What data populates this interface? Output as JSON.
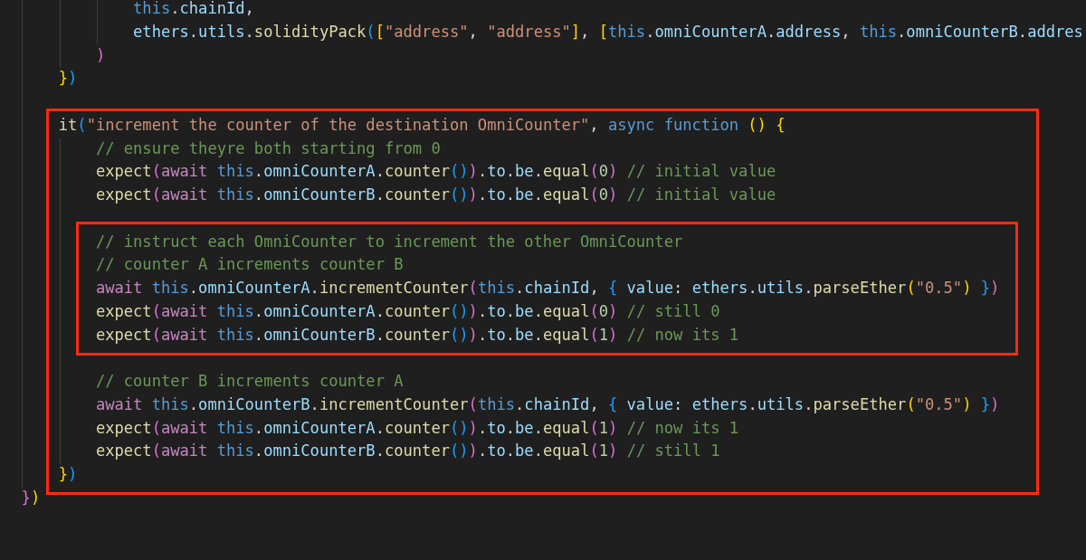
{
  "code": [
    {
      "kind": "block",
      "children": [
        {
          "kind": "block",
          "children": [
            {
              "kind": "block",
              "children": [
                {
                  "kind": "line",
                  "tokens": [
                    {
                      "kind": "keyword",
                      "text": "this"
                    },
                    {
                      "kind": "plain",
                      "text": "."
                    },
                    {
                      "kind": "property",
                      "text": "chainId"
                    },
                    {
                      "kind": "plain",
                      "text": ","
                    }
                  ]
                },
                {
                  "kind": "line",
                  "tokens": [
                    {
                      "kind": "property",
                      "text": "ethers"
                    },
                    {
                      "kind": "plain",
                      "text": "."
                    },
                    {
                      "kind": "property",
                      "text": "utils"
                    },
                    {
                      "kind": "plain",
                      "text": "."
                    },
                    {
                      "kind": "function",
                      "text": "solidityPack"
                    },
                    {
                      "kind": "bracket3",
                      "text": "("
                    },
                    {
                      "kind": "bracket1",
                      "text": "["
                    },
                    {
                      "kind": "string",
                      "text": "\"address\""
                    },
                    {
                      "kind": "plain",
                      "text": ", "
                    },
                    {
                      "kind": "string",
                      "text": "\"address\""
                    },
                    {
                      "kind": "bracket1",
                      "text": "]"
                    },
                    {
                      "kind": "plain",
                      "text": ", "
                    },
                    {
                      "kind": "bracket1",
                      "text": "["
                    },
                    {
                      "kind": "keyword",
                      "text": "this"
                    },
                    {
                      "kind": "plain",
                      "text": "."
                    },
                    {
                      "kind": "property",
                      "text": "omniCounterA"
                    },
                    {
                      "kind": "plain",
                      "text": "."
                    },
                    {
                      "kind": "property",
                      "text": "address"
                    },
                    {
                      "kind": "plain",
                      "text": ", "
                    },
                    {
                      "kind": "keyword",
                      "text": "this"
                    },
                    {
                      "kind": "plain",
                      "text": "."
                    },
                    {
                      "kind": "property",
                      "text": "omniCounterB"
                    },
                    {
                      "kind": "plain",
                      "text": "."
                    },
                    {
                      "kind": "property",
                      "text": "addres"
                    }
                  ]
                }
              ]
            },
            {
              "kind": "line",
              "tokens": [
                {
                  "kind": "bracket2",
                  "text": ")"
                }
              ]
            }
          ]
        },
        {
          "kind": "line",
          "tokens": [
            {
              "kind": "bracket1",
              "text": "}"
            },
            {
              "kind": "bracket3",
              "text": ")"
            }
          ]
        },
        {
          "kind": "blank"
        },
        {
          "kind": "frame",
          "children": [
            {
              "kind": "line",
              "tokens": [
                {
                  "kind": "function",
                  "text": "it"
                },
                {
                  "kind": "bracket3",
                  "text": "("
                },
                {
                  "kind": "string",
                  "text": "\"increment the counter of the destination OmniCounter\""
                },
                {
                  "kind": "plain",
                  "text": ", "
                },
                {
                  "kind": "keyword",
                  "text": "async "
                },
                {
                  "kind": "keyword",
                  "text": "function "
                },
                {
                  "kind": "bracket1",
                  "text": "()"
                },
                {
                  "kind": "bracket1",
                  "text": " {"
                }
              ]
            },
            {
              "kind": "block",
              "children": [
                {
                  "kind": "line",
                  "tokens": [
                    {
                      "kind": "comment",
                      "text": "// ensure theyre both starting from 0"
                    }
                  ]
                },
                {
                  "kind": "line",
                  "tokens": [
                    {
                      "kind": "function",
                      "text": "expect"
                    },
                    {
                      "kind": "bracket2",
                      "text": "("
                    },
                    {
                      "kind": "control",
                      "text": "await "
                    },
                    {
                      "kind": "keyword",
                      "text": "this"
                    },
                    {
                      "kind": "plain",
                      "text": "."
                    },
                    {
                      "kind": "property",
                      "text": "omniCounterA"
                    },
                    {
                      "kind": "plain",
                      "text": "."
                    },
                    {
                      "kind": "function",
                      "text": "counter"
                    },
                    {
                      "kind": "bracket3",
                      "text": "()"
                    },
                    {
                      "kind": "bracket2",
                      "text": ")"
                    },
                    {
                      "kind": "plain",
                      "text": "."
                    },
                    {
                      "kind": "property",
                      "text": "to"
                    },
                    {
                      "kind": "plain",
                      "text": "."
                    },
                    {
                      "kind": "property",
                      "text": "be"
                    },
                    {
                      "kind": "plain",
                      "text": "."
                    },
                    {
                      "kind": "function",
                      "text": "equal"
                    },
                    {
                      "kind": "bracket2",
                      "text": "("
                    },
                    {
                      "kind": "number",
                      "text": "0"
                    },
                    {
                      "kind": "bracket2",
                      "text": ") "
                    },
                    {
                      "kind": "comment",
                      "text": "// initial value"
                    }
                  ]
                },
                {
                  "kind": "line",
                  "tokens": [
                    {
                      "kind": "function",
                      "text": "expect"
                    },
                    {
                      "kind": "bracket2",
                      "text": "("
                    },
                    {
                      "kind": "control",
                      "text": "await "
                    },
                    {
                      "kind": "keyword",
                      "text": "this"
                    },
                    {
                      "kind": "plain",
                      "text": "."
                    },
                    {
                      "kind": "property",
                      "text": "omniCounterB"
                    },
                    {
                      "kind": "plain",
                      "text": "."
                    },
                    {
                      "kind": "function",
                      "text": "counter"
                    },
                    {
                      "kind": "bracket3",
                      "text": "()"
                    },
                    {
                      "kind": "bracket2",
                      "text": ")"
                    },
                    {
                      "kind": "plain",
                      "text": "."
                    },
                    {
                      "kind": "property",
                      "text": "to"
                    },
                    {
                      "kind": "plain",
                      "text": "."
                    },
                    {
                      "kind": "property",
                      "text": "be"
                    },
                    {
                      "kind": "plain",
                      "text": "."
                    },
                    {
                      "kind": "function",
                      "text": "equal"
                    },
                    {
                      "kind": "bracket2",
                      "text": "("
                    },
                    {
                      "kind": "number",
                      "text": "0"
                    },
                    {
                      "kind": "bracket2",
                      "text": ") "
                    },
                    {
                      "kind": "comment",
                      "text": "// initial value"
                    }
                  ]
                },
                {
                  "kind": "blank"
                },
                {
                  "kind": "frame",
                  "children": [
                    {
                      "kind": "line",
                      "tokens": [
                        {
                          "kind": "comment",
                          "text": "// instruct each OmniCounter to increment the other OmniCounter"
                        }
                      ]
                    },
                    {
                      "kind": "line",
                      "tokens": [
                        {
                          "kind": "comment",
                          "text": "// counter A increments counter B"
                        }
                      ]
                    },
                    {
                      "kind": "line",
                      "tokens": [
                        {
                          "kind": "control",
                          "text": "await "
                        },
                        {
                          "kind": "keyword",
                          "text": "this"
                        },
                        {
                          "kind": "plain",
                          "text": "."
                        },
                        {
                          "kind": "property",
                          "text": "omniCounterA"
                        },
                        {
                          "kind": "plain",
                          "text": "."
                        },
                        {
                          "kind": "function",
                          "text": "incrementCounter"
                        },
                        {
                          "kind": "bracket2",
                          "text": "("
                        },
                        {
                          "kind": "keyword",
                          "text": "this"
                        },
                        {
                          "kind": "plain",
                          "text": "."
                        },
                        {
                          "kind": "property",
                          "text": "chainId"
                        },
                        {
                          "kind": "plain",
                          "text": ", "
                        },
                        {
                          "kind": "bracket3",
                          "text": "{ "
                        },
                        {
                          "kind": "property",
                          "text": "value"
                        },
                        {
                          "kind": "plain",
                          "text": ": "
                        },
                        {
                          "kind": "property",
                          "text": "ethers"
                        },
                        {
                          "kind": "plain",
                          "text": "."
                        },
                        {
                          "kind": "property",
                          "text": "utils"
                        },
                        {
                          "kind": "plain",
                          "text": "."
                        },
                        {
                          "kind": "function",
                          "text": "parseEther"
                        },
                        {
                          "kind": "bracket1",
                          "text": "("
                        },
                        {
                          "kind": "string",
                          "text": "\"0.5\""
                        },
                        {
                          "kind": "bracket1",
                          "text": ") "
                        },
                        {
                          "kind": "bracket3",
                          "text": "}"
                        },
                        {
                          "kind": "bracket2",
                          "text": ")"
                        }
                      ]
                    },
                    {
                      "kind": "line",
                      "tokens": [
                        {
                          "kind": "function",
                          "text": "expect"
                        },
                        {
                          "kind": "bracket2",
                          "text": "("
                        },
                        {
                          "kind": "control",
                          "text": "await "
                        },
                        {
                          "kind": "keyword",
                          "text": "this"
                        },
                        {
                          "kind": "plain",
                          "text": "."
                        },
                        {
                          "kind": "property",
                          "text": "omniCounterA"
                        },
                        {
                          "kind": "plain",
                          "text": "."
                        },
                        {
                          "kind": "function",
                          "text": "counter"
                        },
                        {
                          "kind": "bracket3",
                          "text": "()"
                        },
                        {
                          "kind": "bracket2",
                          "text": ")"
                        },
                        {
                          "kind": "plain",
                          "text": "."
                        },
                        {
                          "kind": "property",
                          "text": "to"
                        },
                        {
                          "kind": "plain",
                          "text": "."
                        },
                        {
                          "kind": "property",
                          "text": "be"
                        },
                        {
                          "kind": "plain",
                          "text": "."
                        },
                        {
                          "kind": "function",
                          "text": "equal"
                        },
                        {
                          "kind": "bracket2",
                          "text": "("
                        },
                        {
                          "kind": "number",
                          "text": "0"
                        },
                        {
                          "kind": "bracket2",
                          "text": ") "
                        },
                        {
                          "kind": "comment",
                          "text": "// still 0"
                        }
                      ]
                    },
                    {
                      "kind": "line",
                      "tokens": [
                        {
                          "kind": "function",
                          "text": "expect"
                        },
                        {
                          "kind": "bracket2",
                          "text": "("
                        },
                        {
                          "kind": "control",
                          "text": "await "
                        },
                        {
                          "kind": "keyword",
                          "text": "this"
                        },
                        {
                          "kind": "plain",
                          "text": "."
                        },
                        {
                          "kind": "property",
                          "text": "omniCounterB"
                        },
                        {
                          "kind": "plain",
                          "text": "."
                        },
                        {
                          "kind": "function",
                          "text": "counter"
                        },
                        {
                          "kind": "bracket3",
                          "text": "()"
                        },
                        {
                          "kind": "bracket2",
                          "text": ")"
                        },
                        {
                          "kind": "plain",
                          "text": "."
                        },
                        {
                          "kind": "property",
                          "text": "to"
                        },
                        {
                          "kind": "plain",
                          "text": "."
                        },
                        {
                          "kind": "property",
                          "text": "be"
                        },
                        {
                          "kind": "plain",
                          "text": "."
                        },
                        {
                          "kind": "function",
                          "text": "equal"
                        },
                        {
                          "kind": "bracket2",
                          "text": "("
                        },
                        {
                          "kind": "number",
                          "text": "1"
                        },
                        {
                          "kind": "bracket2",
                          "text": ") "
                        },
                        {
                          "kind": "comment",
                          "text": "// now its 1"
                        }
                      ]
                    }
                  ]
                },
                {
                  "kind": "blank"
                },
                {
                  "kind": "line",
                  "tokens": [
                    {
                      "kind": "comment",
                      "text": "// counter B increments counter A"
                    }
                  ]
                },
                {
                  "kind": "line",
                  "tokens": [
                    {
                      "kind": "control",
                      "text": "await "
                    },
                    {
                      "kind": "keyword",
                      "text": "this"
                    },
                    {
                      "kind": "plain",
                      "text": "."
                    },
                    {
                      "kind": "property",
                      "text": "omniCounterB"
                    },
                    {
                      "kind": "plain",
                      "text": "."
                    },
                    {
                      "kind": "function",
                      "text": "incrementCounter"
                    },
                    {
                      "kind": "bracket2",
                      "text": "("
                    },
                    {
                      "kind": "keyword",
                      "text": "this"
                    },
                    {
                      "kind": "plain",
                      "text": "."
                    },
                    {
                      "kind": "property",
                      "text": "chainId"
                    },
                    {
                      "kind": "plain",
                      "text": ", "
                    },
                    {
                      "kind": "bracket3",
                      "text": "{ "
                    },
                    {
                      "kind": "property",
                      "text": "value"
                    },
                    {
                      "kind": "plain",
                      "text": ": "
                    },
                    {
                      "kind": "property",
                      "text": "ethers"
                    },
                    {
                      "kind": "plain",
                      "text": "."
                    },
                    {
                      "kind": "property",
                      "text": "utils"
                    },
                    {
                      "kind": "plain",
                      "text": "."
                    },
                    {
                      "kind": "function",
                      "text": "parseEther"
                    },
                    {
                      "kind": "bracket1",
                      "text": "("
                    },
                    {
                      "kind": "string",
                      "text": "\"0.5\""
                    },
                    {
                      "kind": "bracket1",
                      "text": ") "
                    },
                    {
                      "kind": "bracket3",
                      "text": "}"
                    },
                    {
                      "kind": "bracket2",
                      "text": ")"
                    }
                  ]
                },
                {
                  "kind": "line",
                  "tokens": [
                    {
                      "kind": "function",
                      "text": "expect"
                    },
                    {
                      "kind": "bracket2",
                      "text": "("
                    },
                    {
                      "kind": "control",
                      "text": "await "
                    },
                    {
                      "kind": "keyword",
                      "text": "this"
                    },
                    {
                      "kind": "plain",
                      "text": "."
                    },
                    {
                      "kind": "property",
                      "text": "omniCounterA"
                    },
                    {
                      "kind": "plain",
                      "text": "."
                    },
                    {
                      "kind": "function",
                      "text": "counter"
                    },
                    {
                      "kind": "bracket3",
                      "text": "()"
                    },
                    {
                      "kind": "bracket2",
                      "text": ")"
                    },
                    {
                      "kind": "plain",
                      "text": "."
                    },
                    {
                      "kind": "property",
                      "text": "to"
                    },
                    {
                      "kind": "plain",
                      "text": "."
                    },
                    {
                      "kind": "property",
                      "text": "be"
                    },
                    {
                      "kind": "plain",
                      "text": "."
                    },
                    {
                      "kind": "function",
                      "text": "equal"
                    },
                    {
                      "kind": "bracket2",
                      "text": "("
                    },
                    {
                      "kind": "number",
                      "text": "1"
                    },
                    {
                      "kind": "bracket2",
                      "text": ") "
                    },
                    {
                      "kind": "comment",
                      "text": "// now its 1"
                    }
                  ]
                },
                {
                  "kind": "line",
                  "tokens": [
                    {
                      "kind": "function",
                      "text": "expect"
                    },
                    {
                      "kind": "bracket2",
                      "text": "("
                    },
                    {
                      "kind": "control",
                      "text": "await "
                    },
                    {
                      "kind": "keyword",
                      "text": "this"
                    },
                    {
                      "kind": "plain",
                      "text": "."
                    },
                    {
                      "kind": "property",
                      "text": "omniCounterB"
                    },
                    {
                      "kind": "plain",
                      "text": "."
                    },
                    {
                      "kind": "function",
                      "text": "counter"
                    },
                    {
                      "kind": "bracket3",
                      "text": "()"
                    },
                    {
                      "kind": "bracket2",
                      "text": ")"
                    },
                    {
                      "kind": "plain",
                      "text": "."
                    },
                    {
                      "kind": "property",
                      "text": "to"
                    },
                    {
                      "kind": "plain",
                      "text": "."
                    },
                    {
                      "kind": "property",
                      "text": "be"
                    },
                    {
                      "kind": "plain",
                      "text": "."
                    },
                    {
                      "kind": "function",
                      "text": "equal"
                    },
                    {
                      "kind": "bracket2",
                      "text": "("
                    },
                    {
                      "kind": "number",
                      "text": "1"
                    },
                    {
                      "kind": "bracket2",
                      "text": ") "
                    },
                    {
                      "kind": "comment",
                      "text": "// still 1"
                    }
                  ]
                }
              ]
            },
            {
              "kind": "line",
              "tokens": [
                {
                  "kind": "bracket1",
                  "text": "}"
                },
                {
                  "kind": "bracket3",
                  "text": ")"
                }
              ]
            }
          ]
        }
      ]
    },
    {
      "kind": "line",
      "tokens": [
        {
          "kind": "bracket2",
          "text": "}"
        },
        {
          "kind": "bracket1",
          "text": ")"
        }
      ]
    }
  ]
}
